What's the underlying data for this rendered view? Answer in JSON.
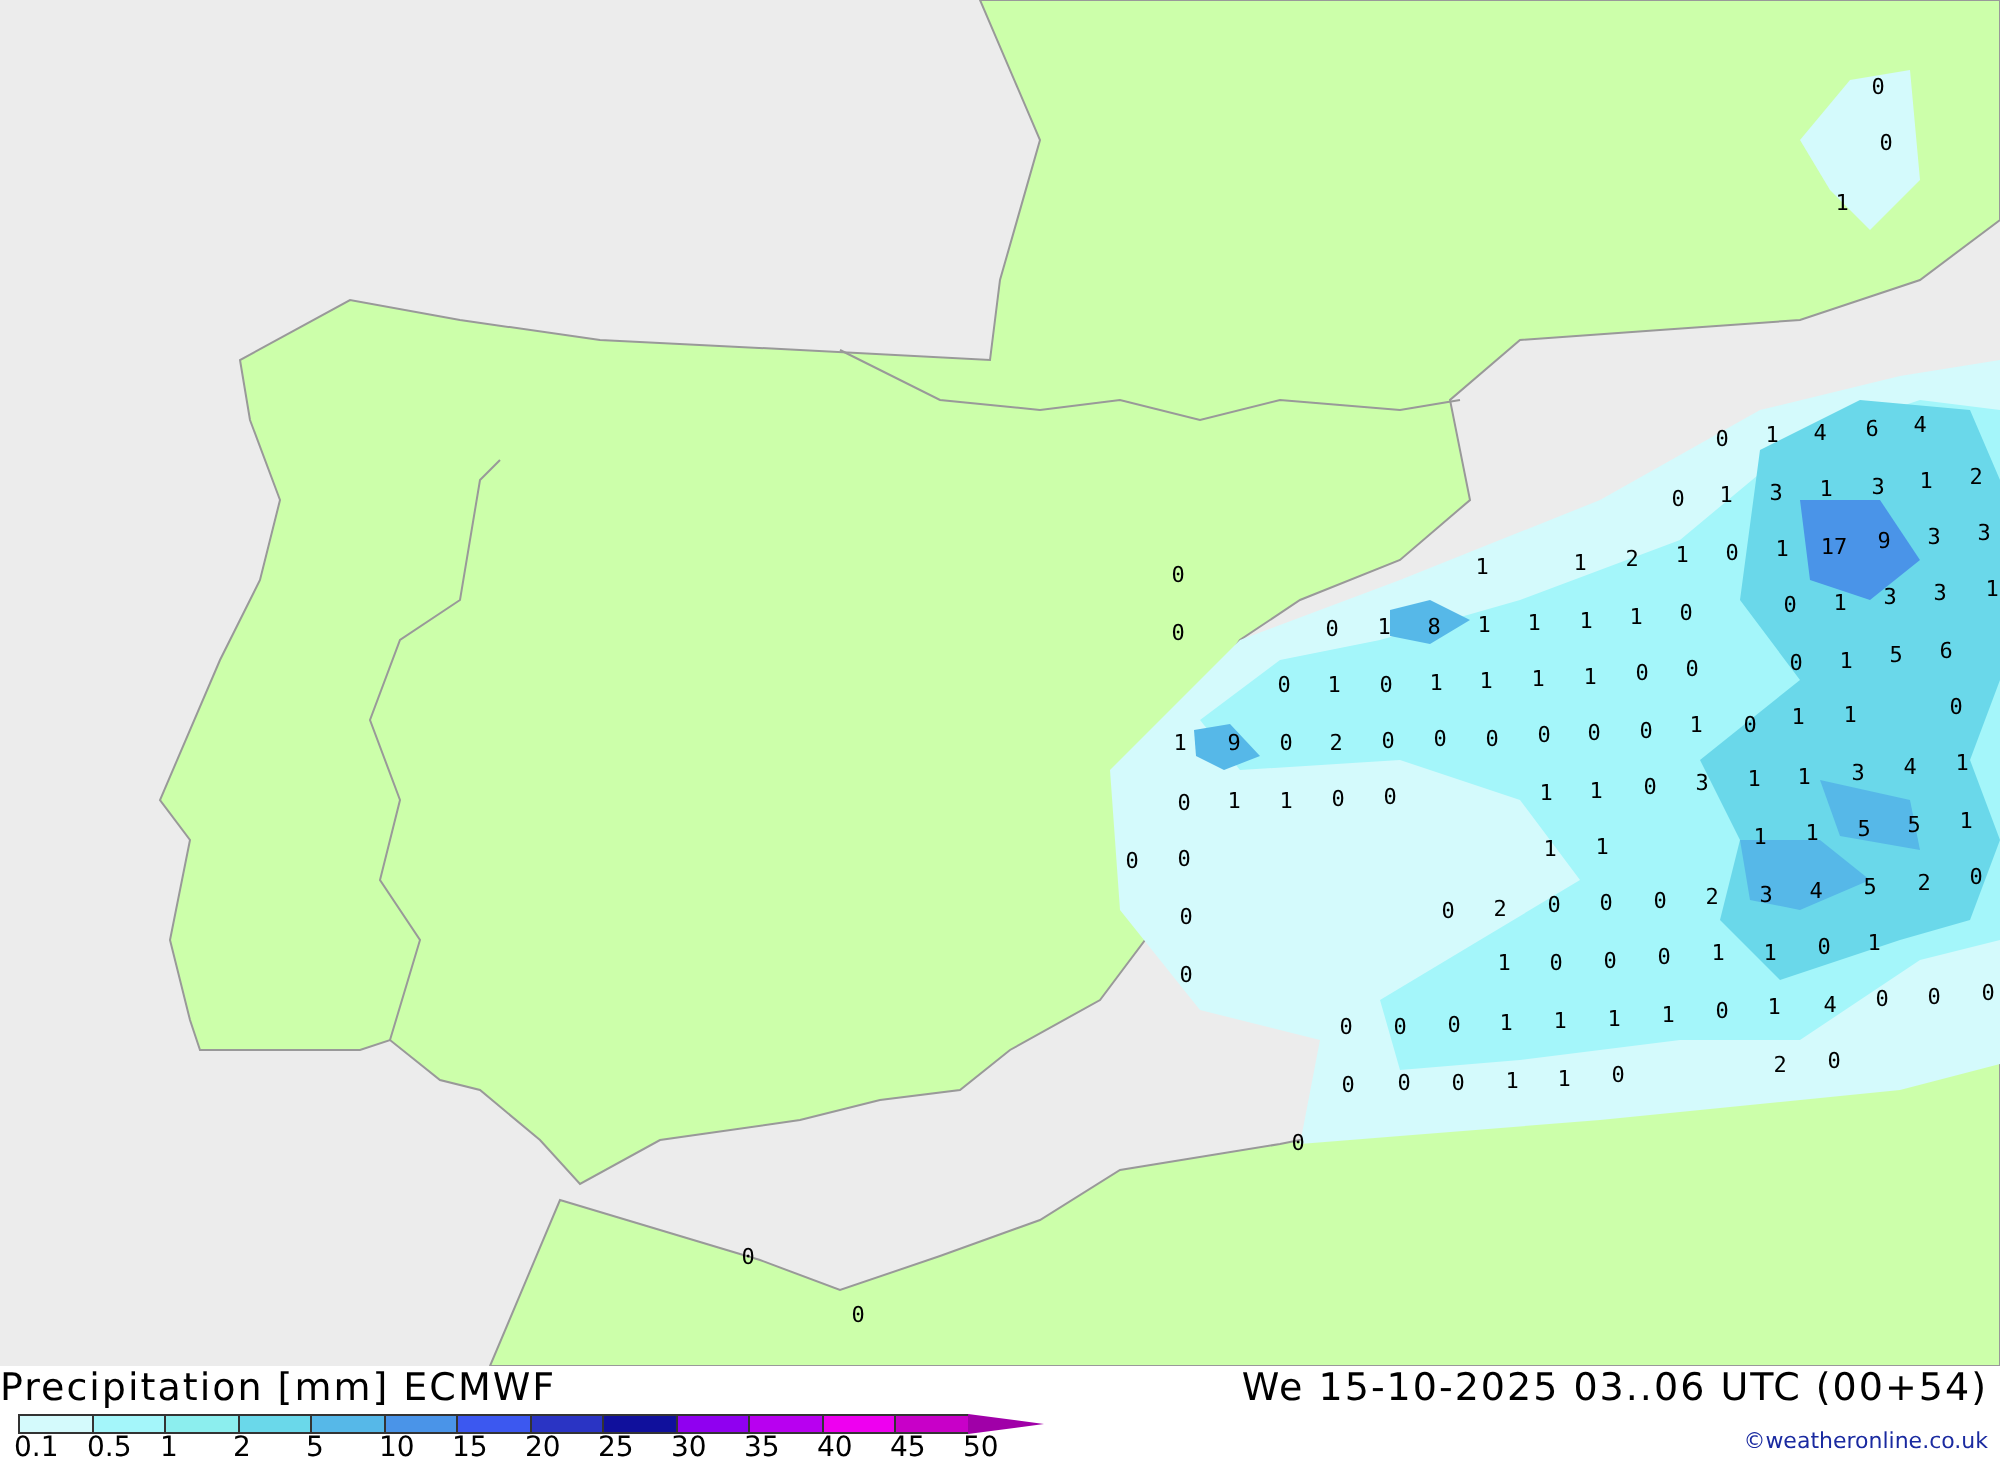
{
  "map": {
    "values": [
      "0",
      "0",
      "1",
      "0",
      "1",
      "4",
      "6",
      "4",
      "0",
      "1",
      "3",
      "1",
      "3",
      "1",
      "2",
      "1",
      "1",
      "2",
      "1",
      "0",
      "1",
      "17",
      "9",
      "3",
      "3",
      "0",
      "0",
      "0",
      "1",
      "3",
      "3",
      "1",
      "0",
      "1",
      "8",
      "1",
      "1",
      "1",
      "1",
      "0",
      "0",
      "1",
      "5",
      "6",
      "0",
      "1",
      "0",
      "1",
      "1",
      "1",
      "1",
      "0",
      "0",
      "0",
      "1",
      "0",
      "1",
      "1",
      "1",
      "9",
      "0",
      "2",
      "0",
      "0",
      "0",
      "0",
      "0",
      "0",
      "3",
      "1",
      "1",
      "3",
      "4",
      "1",
      "0",
      "1",
      "1",
      "0",
      "0",
      "1",
      "1",
      "0",
      "1",
      "1",
      "5",
      "5",
      "1",
      "0",
      "0",
      "1",
      "1",
      "2",
      "3",
      "4",
      "5",
      "2",
      "0",
      "0",
      "2",
      "0",
      "0",
      "0",
      "0",
      "1",
      "1",
      "0",
      "1",
      "1",
      "0",
      "0",
      "0",
      "0",
      "0",
      "1",
      "4",
      "0",
      "0",
      "0",
      "0",
      "0",
      "0",
      "1",
      "1",
      "1",
      "1",
      "2",
      "0",
      "0",
      "0",
      "0",
      "1",
      "1",
      "0",
      "0",
      "0",
      "0"
    ]
  },
  "legend": {
    "title": "Precipitation [mm] ECMWF",
    "items": [
      {
        "label": "0.1",
        "color": "#d4fafc"
      },
      {
        "label": "0.5",
        "color": "#a4f6fa"
      },
      {
        "label": "1",
        "color": "#8ceeee"
      },
      {
        "label": "2",
        "color": "#6ad8ea"
      },
      {
        "label": "5",
        "color": "#56b8e8"
      },
      {
        "label": "10",
        "color": "#4a94e8"
      },
      {
        "label": "15",
        "color": "#3c58f0"
      },
      {
        "label": "20",
        "color": "#2a34c4"
      },
      {
        "label": "25",
        "color": "#10109c"
      },
      {
        "label": "30",
        "color": "#9000f0"
      },
      {
        "label": "35",
        "color": "#b800f0"
      },
      {
        "label": "40",
        "color": "#ee00f0"
      },
      {
        "label": "45",
        "color": "#c800c8"
      },
      {
        "label": "50",
        "color": "#a000a8"
      }
    ]
  },
  "valid_time": "We 15-10-2025 03..06 UTC (00+54)",
  "credit": "©weatheronline.co.uk"
}
